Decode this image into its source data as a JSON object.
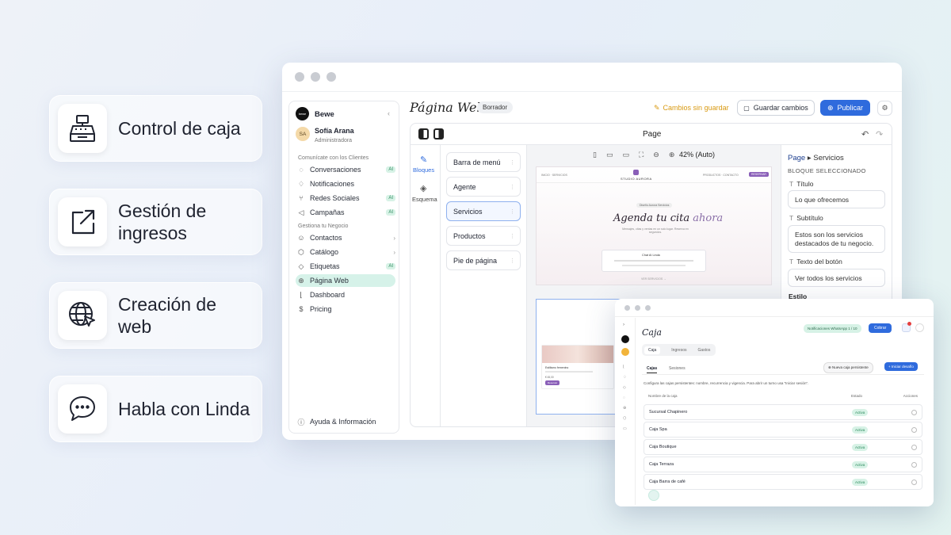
{
  "features": [
    {
      "label": "Control de caja",
      "icon": "cash-register-icon"
    },
    {
      "label": "Gestión de ingresos",
      "icon": "external-link-icon"
    },
    {
      "label": "Creación de web",
      "icon": "globe-cursor-icon"
    },
    {
      "label": "Habla con Linda",
      "icon": "chat-bubble-icon"
    }
  ],
  "sidebar": {
    "brand": "Bewe",
    "brand_logo": "bewe",
    "user_initials": "SA",
    "user_name": "Sofía Arana",
    "user_role": "Administradora",
    "section1": "Comunícate con los Clientes",
    "section2": "Gestiona tu Negocio",
    "items": [
      {
        "label": "Conversaciones",
        "icon": "chat-icon",
        "badge": "AI"
      },
      {
        "label": "Notificaciones",
        "icon": "bell-icon"
      },
      {
        "label": "Redes Sociales",
        "icon": "share-icon",
        "badge": "AI"
      },
      {
        "label": "Campañas",
        "icon": "megaphone-icon",
        "badge": "AI"
      },
      {
        "label": "Contactos",
        "icon": "users-icon"
      },
      {
        "label": "Catálogo",
        "icon": "box-icon"
      },
      {
        "label": "Etiquetas",
        "icon": "tag-icon",
        "badge": "AI"
      },
      {
        "label": "Página Web",
        "icon": "globe-icon"
      },
      {
        "label": "Dashboard",
        "icon": "chart-icon"
      },
      {
        "label": "Pricing",
        "icon": "dollar-icon"
      }
    ],
    "help": "Ayuda & Información"
  },
  "header": {
    "title": "Página Web",
    "status": "Borrador",
    "unsaved": "Cambios sin guardar",
    "save": "Guardar cambios",
    "publish": "Publicar"
  },
  "editor": {
    "page_label": "Page",
    "tabs": [
      "Bloques",
      "Esquema"
    ],
    "blocks": [
      "Barra de menú",
      "Agente",
      "Servicios",
      "Productos",
      "Pie de página"
    ],
    "zoom": "42% (Auto)",
    "preview": {
      "nav_left": "INICIO · SERVICIOS",
      "brand": "STUDIO AURORA",
      "nav_right": "PRODUCTOS · CONTACTO",
      "nav_btn": "RESERVAR",
      "pill": "Diseño Aurora Servicios",
      "headline": "Agenda tu cita",
      "headline_em": "ahora",
      "sub": "Mensajes, citas y ventas en un solo lugar. Reserva en segundos.",
      "card_title": "Chat AI Linda",
      "card_link": "VER SERVICIOS →",
      "thumb_title": "Estilismo femenino",
      "thumb_price": "€ 45,00",
      "thumb_btn": "Reservar"
    }
  },
  "panel": {
    "crumb_root": "Page",
    "crumb_current": "Servicios",
    "section": "BLOQUE SELECCIONADO",
    "title_label": "Título",
    "title_value": "Lo que ofrecemos",
    "subtitle_label": "Subtítulo",
    "subtitle_value": "Estos son los servicios destacados de tu negocio.",
    "button_label": "Texto del botón",
    "button_value": "Ver todos los servicios",
    "style_label": "Estilo"
  },
  "caja": {
    "title": "Caja",
    "top_badge": "Notificaciones WhatsApp 1 / 10",
    "top_btn": "Cobrar",
    "tabs": [
      "Caja",
      "Ingresos",
      "Gastos"
    ],
    "subtabs": [
      "Cajas",
      "Sesiones"
    ],
    "btn_secondary": "Nueva caja persistente",
    "btn_primary": "Iniciar desafío",
    "desc": "Configura las cajas persistentes: nombre, recurrencia y vigencia. Para abrir un turno usa \"Iniciar sesión\".",
    "columns": [
      "Nombre de la caja",
      "Estado",
      "Acciones"
    ],
    "rows": [
      {
        "name": "Sucursal Chapinero",
        "status": "Activa"
      },
      {
        "name": "Caja Spa",
        "status": "Activa"
      },
      {
        "name": "Caja Boutique",
        "status": "Activa"
      },
      {
        "name": "Caja Terraza",
        "status": "Activa"
      },
      {
        "name": "Caja Barra de café",
        "status": "Activa"
      }
    ]
  },
  "colors": {
    "primary": "#2f6bdd",
    "accent_green": "#d6f2e9",
    "warning": "#e0a11b"
  }
}
